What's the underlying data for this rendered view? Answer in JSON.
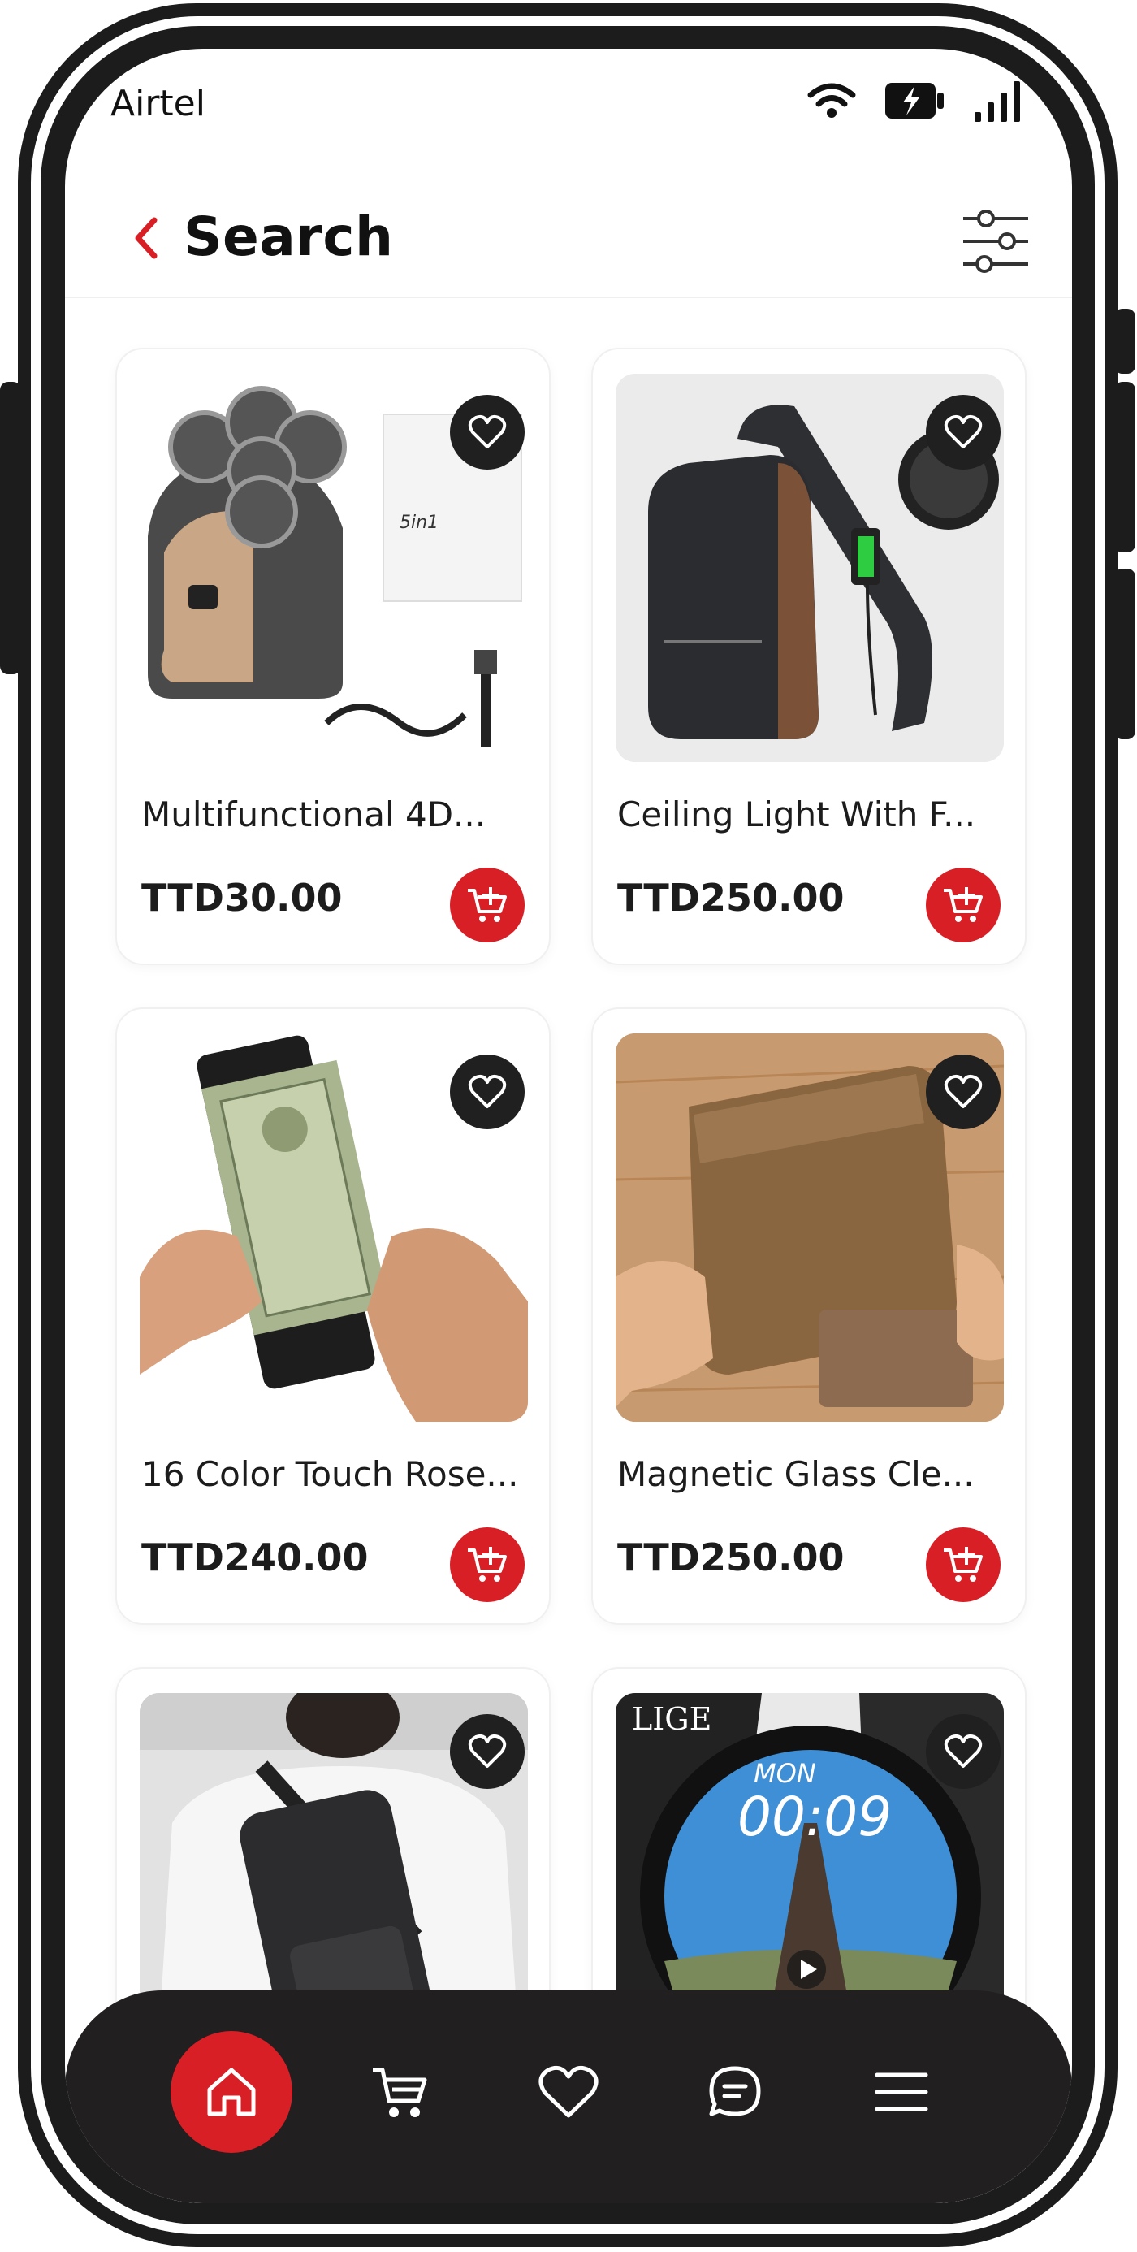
{
  "status_bar": {
    "carrier": "Airtel",
    "icons": [
      "wifi-icon",
      "battery-charging-icon",
      "signal-icon"
    ]
  },
  "header": {
    "title": "Search",
    "back_icon": "chevron-left-icon",
    "filter_icon": "sliders-icon"
  },
  "products": [
    {
      "name": "Multifunctional 4D...",
      "price": "TTD30.00",
      "image": "shaver-kit"
    },
    {
      "name": "Ceiling Light With F...",
      "price": "TTD250.00",
      "image": "sling-bag"
    },
    {
      "name": "16 Color Touch Rose...",
      "price": "TTD240.00",
      "image": "card-wallet"
    },
    {
      "name": "Magnetic Glass Cle...",
      "price": "TTD250.00",
      "image": "leather-wallet"
    },
    {
      "name": "",
      "price": "",
      "image": "chest-bag"
    },
    {
      "name": "",
      "price": "",
      "image": "smart-watch"
    }
  ],
  "product_icons": {
    "favorite": "heart-icon",
    "add_to_cart": "cart-plus-icon"
  },
  "watch_face": {
    "brand": "LIGE",
    "day": "MON",
    "time": "00:09"
  },
  "bottom_nav": [
    {
      "id": "home",
      "icon": "home-icon",
      "active": true
    },
    {
      "id": "cart",
      "icon": "cart-icon",
      "active": false
    },
    {
      "id": "wishlist",
      "icon": "heart-icon",
      "active": false
    },
    {
      "id": "chat",
      "icon": "chat-icon",
      "active": false
    },
    {
      "id": "menu",
      "icon": "menu-icon",
      "active": false
    }
  ],
  "colors": {
    "accent": "#d81f26",
    "dark": "#221f20",
    "text": "#1c1c1c"
  }
}
